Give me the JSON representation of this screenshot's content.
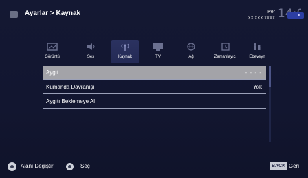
{
  "header": {
    "breadcrumb": "Ayarlar > Kaynak",
    "day": "Per",
    "date": "XX XXX XXXX",
    "time": "14:00"
  },
  "tabs": [
    {
      "label": "Görüntü",
      "icon": "picture-icon",
      "active": false
    },
    {
      "label": "Ses",
      "icon": "speaker-icon",
      "active": false
    },
    {
      "label": "Kaynak",
      "icon": "antenna-icon",
      "active": true
    },
    {
      "label": "TV",
      "icon": "tv-icon",
      "active": false
    },
    {
      "label": "Ağ",
      "icon": "network-icon",
      "active": false
    },
    {
      "label": "Zamanlayıcı",
      "icon": "timer-icon",
      "active": false
    },
    {
      "label": "Ebeveyn",
      "icon": "parental-icon",
      "active": false
    }
  ],
  "list": [
    {
      "name": "Aygıt",
      "value": "- - - -",
      "selected": true
    },
    {
      "name": "Kumanda Davranışı",
      "value": "Yok",
      "selected": false
    },
    {
      "name": "Aygıtı Beklemeye Al",
      "value": "",
      "selected": false
    }
  ],
  "footer": {
    "nav_hint": "Alanı Değiştir",
    "ok_hint": "Seç",
    "back_key": "BACK",
    "back_hint": "- Geri"
  },
  "colors": {
    "background": "#141833",
    "selected_row": "#a3a3a8",
    "active_tab": "#2b3260",
    "clock_accent": "#2c3ea3"
  }
}
